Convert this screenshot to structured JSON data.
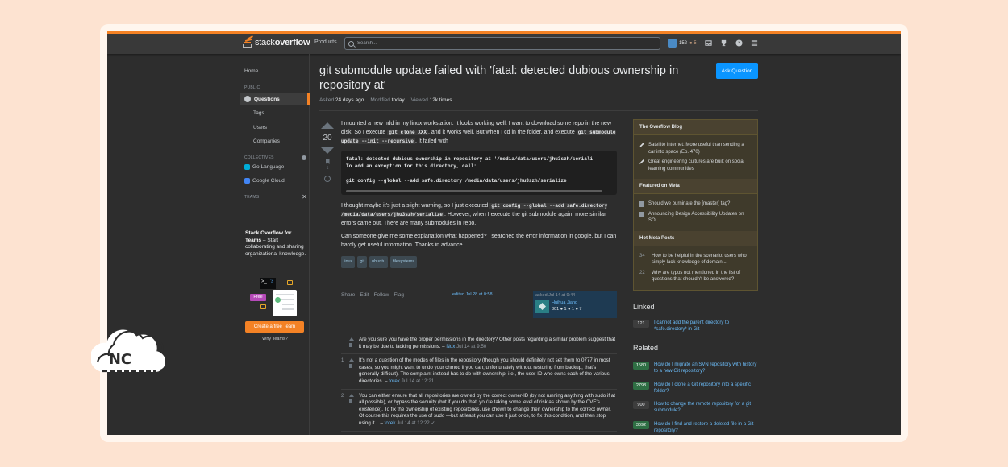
{
  "topbar": {
    "logo_word_plain": "stack",
    "logo_word_bold": "overflow",
    "products": "Products",
    "search_placeholder": "Search...",
    "rep": "152",
    "bronze": "● 5"
  },
  "leftnav": {
    "home": "Home",
    "public": "PUBLIC",
    "questions": "Questions",
    "tags": "Tags",
    "users": "Users",
    "companies": "Companies",
    "collectives": "COLLECTIVES",
    "go": "Go Language",
    "gcloud": "Google Cloud",
    "teams": "TEAMS",
    "teams_title_bold": "Stack Overflow for Teams",
    "teams_title_rest": " – Start collaborating and sharing organizational knowledge.",
    "free": "Free",
    "create_team": "Create a free Team",
    "why_teams": "Why Teams?"
  },
  "question": {
    "title": "git submodule update failed with 'fatal: detected dubious ownership in repository at'",
    "ask_button": "Ask Question",
    "asked_label": "Asked",
    "asked_value": "24 days ago",
    "modified_label": "Modified",
    "modified_value": "today",
    "viewed_label": "Viewed",
    "viewed_value": "12k times",
    "score": "20",
    "bookmarks": "1",
    "p1a": "I mounted a new hdd in my linux workstation. It looks working well. I want to download some repo in the new disk. So I execute ",
    "p1code1": "git clone XXX",
    "p1b": ", and it works well. But when I cd in the folder, and execute ",
    "p1code2": "git submodule update --init --recursive",
    "p1c": ". It failed with",
    "code_block": "fatal: detected dubious ownership in repository at '/media/data/users/jhu3szh/seriali\nTo add an exception for this directory, call:\n\ngit config --global --add safe.directory /media/data/users/jhu3szh/serialize",
    "p2a": "I thought maybe it's just a slight warning, so I just executed ",
    "p2code": "git config --global --add safe.directory /media/data/users/jhu3szh/serialize",
    "p2b": ". However, when I execute the git submodule again, more similar errors came out. There are many submodules in repo.",
    "p3": "Can someone give me some explanation what happened? I searched the error information in google, but I can hardly get useful information. Thanks in advance.",
    "tags": [
      "linux",
      "git",
      "ubuntu",
      "filesystems"
    ],
    "actions": [
      "Share",
      "Edit",
      "Follow",
      "Flag"
    ],
    "edited": "edited Jul 28 at 0:58",
    "owner_asked": "asked Jul 14 at 9:44",
    "owner_name": "Huihua Jiang",
    "owner_rep": "301 ● 1 ● 1 ● 7"
  },
  "comments": [
    {
      "num": "",
      "text": "Are you sure you have the proper permissions in the directory? Other posts regarding a similar problem suggest that it may be due to lacking permissions. – ",
      "user": "Nox",
      "ts": " Jul 14 at 9:50"
    },
    {
      "num": "1",
      "text": "It's not a question of the modes of files in the repository (though you should definitely not set them to 0777 in most cases, so you might want to undo your chmod if you can; unfortunately without restoring from backup, that's generally difficult). The complaint instead has to do with ownership, i.e., the user-ID who owns each of the various directories. – ",
      "user": "torek",
      "ts": " Jul 14 at 12:21"
    },
    {
      "num": "2",
      "text": "You can either ensure that all repositories are owned by the correct owner-ID (by not running anything with sudo if at all possible), or bypass the security (but if you do that, you're taking some level of risk as shown by the CVE's existence). To fix the ownership of existing repositories, use chown to change their ownership to the correct owner. Of course this requires the use of sudo —but at least you can use it just once, to fix this condition, and then stop using it... – ",
      "user": "torek",
      "ts": " Jul 14 at 12:22 ✓"
    }
  ],
  "sidebar": {
    "blog_title": "The Overflow Blog",
    "blog_items": [
      "Satellite internet: More useful than sending a car into space (Ep. 470)",
      "Great engineering cultures are built on social learning communities"
    ],
    "meta_title": "Featured on Meta",
    "meta_items": [
      "Should we burninate the [master] tag?",
      "Announcing Design Accessibility Updates on SO"
    ],
    "hot_title": "Hot Meta Posts",
    "hot_items": [
      {
        "num": "34",
        "text": "How to be helpful in the scenario: users who simply lack knowledge of domain..."
      },
      {
        "num": "22",
        "text": "Why are typos not mentioned in the list of questions that shouldn't be answered?"
      }
    ],
    "linked_title": "Linked",
    "linked": [
      {
        "count": "121",
        "text": "I cannot add the parent directory to *safe.directory* in Git"
      }
    ],
    "related_title": "Related",
    "related": [
      {
        "count": "1580",
        "text": "How do I migrate an SVN repository with history to a new Git repository?"
      },
      {
        "count": "2793",
        "text": "How do I clone a Git repository into a specific folder?"
      },
      {
        "count": "900",
        "text": "How to change the remote repository for a git submodule?"
      },
      {
        "count": "3092",
        "text": "How do I find and restore a deleted file in a Git repository?"
      }
    ]
  },
  "watermark": {
    "text": "NC"
  }
}
